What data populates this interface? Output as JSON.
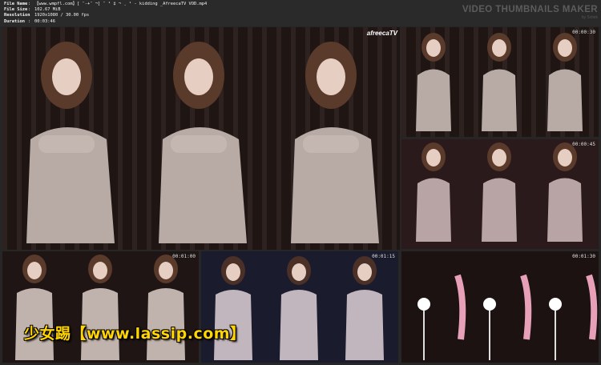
{
  "file_info": {
    "rows": [
      {
        "label": "File Name",
        "value": "【www.wmpfl.com】[ ¨-+¨ ¬] ¨ ¹ ‡ ¬ ¸ ¹ - kidding _AfreecaTV VOD.mp4"
      },
      {
        "label": "File Size",
        "value": "102.67 MiB"
      },
      {
        "label": "Resolution",
        "value": "1920x1080 / 30.00 fps"
      },
      {
        "label": "Duration",
        "value": "00:03:46"
      }
    ],
    "separator": ":"
  },
  "branding": {
    "title": "VIDEO THUMBNAILS MAKER",
    "subtitle": "by Scitek"
  },
  "thumbnails": [
    {
      "id": "main",
      "logo": "afreecaTV"
    },
    {
      "id": "t2",
      "timestamp": "00:00:30",
      "scene": "dancer"
    },
    {
      "id": "t3",
      "timestamp": "00:00:45",
      "scene": "dancer"
    },
    {
      "id": "t4",
      "timestamp": "00:01:00",
      "scene": "dancer"
    },
    {
      "id": "t5",
      "timestamp": "00:01:15",
      "scene": "dancer-blue"
    },
    {
      "id": "t6",
      "timestamp": "00:01:30",
      "scene": "stage"
    }
  ],
  "watermark": "少女踢【www.lassip.com】",
  "colors": {
    "background": "#262626",
    "watermark": "#ffd400",
    "dress": "#b9aaa5"
  }
}
